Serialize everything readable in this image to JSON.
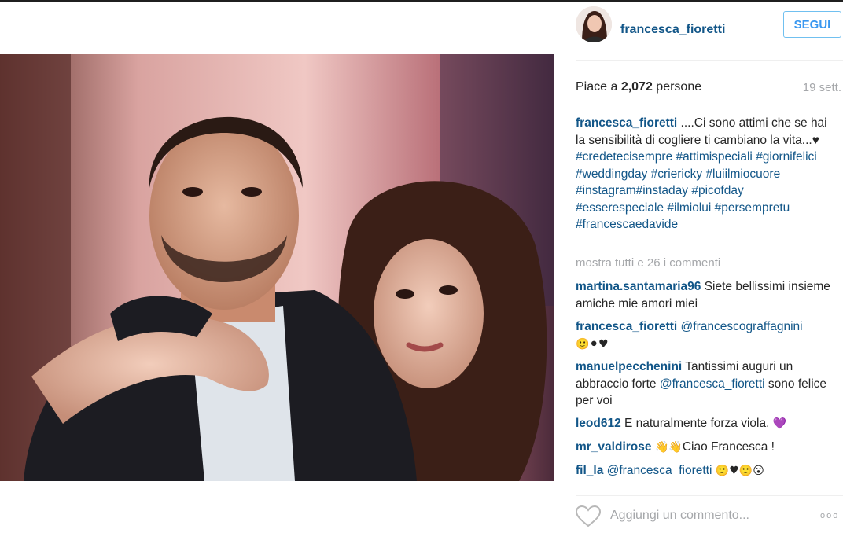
{
  "post": {
    "username": "francesca_fioretti",
    "follow_label": "SEGUI",
    "likes_prefix": "Piace a ",
    "likes_count": "2,072",
    "likes_suffix": " persone",
    "time_ago": "19 sett.",
    "caption": {
      "user": "francesca_fioretti",
      "text": " ....Ci sono attimi che se hai la sensibilità di cogliere ti cambiano la vita...",
      "heart": "♥",
      "hashtags": [
        "#credetecisempre",
        "#attimispeciali",
        "#giornifelici",
        "#weddingday",
        "#criericky",
        "#luiilmiocuore",
        "#instagram#instaday",
        "#picofday",
        "#esserespeciale",
        "#ilmiolui",
        "#persempretu",
        "#francescaedavide"
      ]
    },
    "view_all_comments": "mostra tutti e 26 i commenti",
    "comments": [
      {
        "user": "martina.santamaria96",
        "text": " Siete bellissimi insieme amiche mie amori miei"
      },
      {
        "user": "francesca_fioretti",
        "mention": "@francescograffagnini",
        "emoji": "🙂⚫♥"
      },
      {
        "user": "manuelpecchenini",
        "text": " Tantissimi auguri un abbraccio forte ",
        "mention": "@francesca_fioretti",
        "text2": " sono felice per voi"
      },
      {
        "user": "leod612",
        "text": " E naturalmente forza viola. ",
        "emoji": "💜"
      },
      {
        "user": "mr_valdirose",
        "emoji": " 👋👋",
        "text": "Ciao Francesca !"
      },
      {
        "user": "fil_la",
        "mention": "@francesca_fioretti",
        "emoji": " 🙂♥🙂😮"
      }
    ],
    "add_comment_placeholder": "Aggiungi un commento...",
    "more_options": "ooo"
  },
  "colors": {
    "username_blue": "#125688",
    "follow_blue": "#3897f0",
    "muted_gray": "#a5a7aa",
    "text_dark": "#262626"
  },
  "icons": {
    "like": "heart-outline-icon",
    "more": "more-options-icon"
  }
}
